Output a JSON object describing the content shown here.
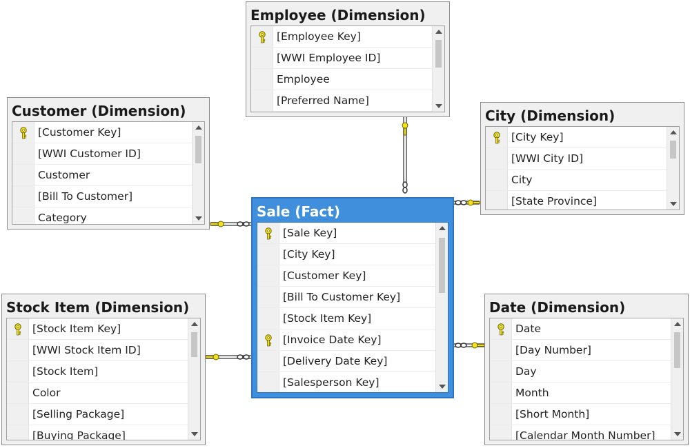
{
  "tables": {
    "employee": {
      "title": "Employee (Dimension)",
      "columns": [
        {
          "label": "[Employee Key]",
          "key": true
        },
        {
          "label": "[WWI Employee ID]",
          "key": false
        },
        {
          "label": "Employee",
          "key": false
        },
        {
          "label": "[Preferred Name]",
          "key": false
        }
      ]
    },
    "customer": {
      "title": "Customer (Dimension)",
      "columns": [
        {
          "label": "[Customer Key]",
          "key": true
        },
        {
          "label": "[WWI Customer ID]",
          "key": false
        },
        {
          "label": "Customer",
          "key": false
        },
        {
          "label": "[Bill To Customer]",
          "key": false
        },
        {
          "label": "Category",
          "key": false
        }
      ]
    },
    "city": {
      "title": "City (Dimension)",
      "columns": [
        {
          "label": "[City Key]",
          "key": true
        },
        {
          "label": "[WWI City ID]",
          "key": false
        },
        {
          "label": "City",
          "key": false
        },
        {
          "label": "[State Province]",
          "key": false
        }
      ]
    },
    "sale": {
      "title": "Sale (Fact)",
      "columns": [
        {
          "label": "[Sale Key]",
          "key": true
        },
        {
          "label": "[City Key]",
          "key": false
        },
        {
          "label": "[Customer Key]",
          "key": false
        },
        {
          "label": "[Bill To Customer Key]",
          "key": false
        },
        {
          "label": "[Stock Item Key]",
          "key": false
        },
        {
          "label": "[Invoice Date Key]",
          "key": true
        },
        {
          "label": "[Delivery Date Key]",
          "key": false
        },
        {
          "label": "[Salesperson Key]",
          "key": false
        }
      ]
    },
    "stock_item": {
      "title": "Stock Item (Dimension)",
      "columns": [
        {
          "label": "[Stock Item Key]",
          "key": true
        },
        {
          "label": "[WWI Stock Item ID]",
          "key": false
        },
        {
          "label": "[Stock Item]",
          "key": false
        },
        {
          "label": "Color",
          "key": false
        },
        {
          "label": "[Selling Package]",
          "key": false
        },
        {
          "label": "[Buying Package]",
          "key": false
        }
      ]
    },
    "date": {
      "title": "Date (Dimension)",
      "columns": [
        {
          "label": "Date",
          "key": true
        },
        {
          "label": "[Day Number]",
          "key": false
        },
        {
          "label": "Day",
          "key": false
        },
        {
          "label": "Month",
          "key": false
        },
        {
          "label": "[Short Month]",
          "key": false
        },
        {
          "label": "[Calendar Month Number]",
          "key": false
        }
      ]
    }
  },
  "colors": {
    "fact_header": "#3f8fdc",
    "key_icon": "#f2e21a",
    "connector_line": "#555555"
  },
  "icons": {
    "primary_key": "key-icon",
    "one_end": "key-icon",
    "many_end": "infinity-icon"
  }
}
